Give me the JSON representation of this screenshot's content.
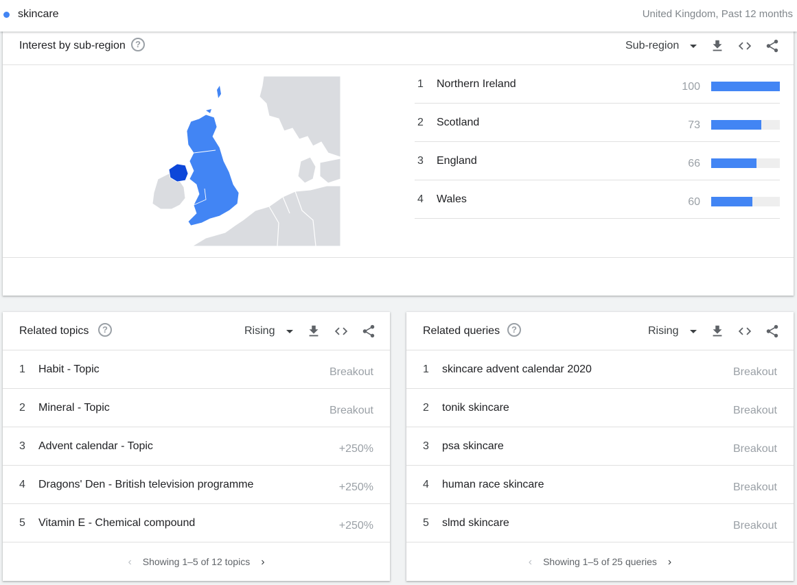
{
  "search": {
    "term": "skincare",
    "meta": "United Kingdom, Past 12 months",
    "term_color": "#4285f4"
  },
  "region_card": {
    "title": "Interest by sub-region",
    "dropdown": "Sub-region",
    "rows": [
      {
        "rank": "1",
        "name": "Northern Ireland",
        "value": 100
      },
      {
        "rank": "2",
        "name": "Scotland",
        "value": 73
      },
      {
        "rank": "3",
        "name": "England",
        "value": 66
      },
      {
        "rank": "4",
        "name": "Wales",
        "value": 60
      }
    ],
    "colors": {
      "bar": "#4285f4",
      "map_high": "#0d47d9",
      "map_mid": "#4285f4",
      "map_other": "#dadce0"
    }
  },
  "topics_card": {
    "title": "Related topics",
    "dropdown": "Rising",
    "rows": [
      {
        "rank": "1",
        "label": "Habit - Topic",
        "value": "Breakout"
      },
      {
        "rank": "2",
        "label": "Mineral - Topic",
        "value": "Breakout"
      },
      {
        "rank": "3",
        "label": "Advent calendar - Topic",
        "value": "+250%"
      },
      {
        "rank": "4",
        "label": "Dragons' Den - British television programme",
        "value": "+250%"
      },
      {
        "rank": "5",
        "label": "Vitamin E - Chemical compound",
        "value": "+250%"
      }
    ],
    "pager": "Showing 1–5 of 12 topics"
  },
  "queries_card": {
    "title": "Related queries",
    "dropdown": "Rising",
    "rows": [
      {
        "rank": "1",
        "label": "skincare advent calendar 2020",
        "value": "Breakout"
      },
      {
        "rank": "2",
        "label": "tonik skincare",
        "value": "Breakout"
      },
      {
        "rank": "3",
        "label": "psa skincare",
        "value": "Breakout"
      },
      {
        "rank": "4",
        "label": "human race skincare",
        "value": "Breakout"
      },
      {
        "rank": "5",
        "label": "slmd skincare",
        "value": "Breakout"
      }
    ],
    "pager": "Showing 1–5 of 25 queries"
  },
  "icons": {
    "help": "help-circle-icon",
    "dropdown": "caret-down-icon",
    "download": "download-icon",
    "embed": "embed-code-icon",
    "share": "share-icon",
    "prev": "chevron-left-icon",
    "next": "chevron-right-icon"
  }
}
